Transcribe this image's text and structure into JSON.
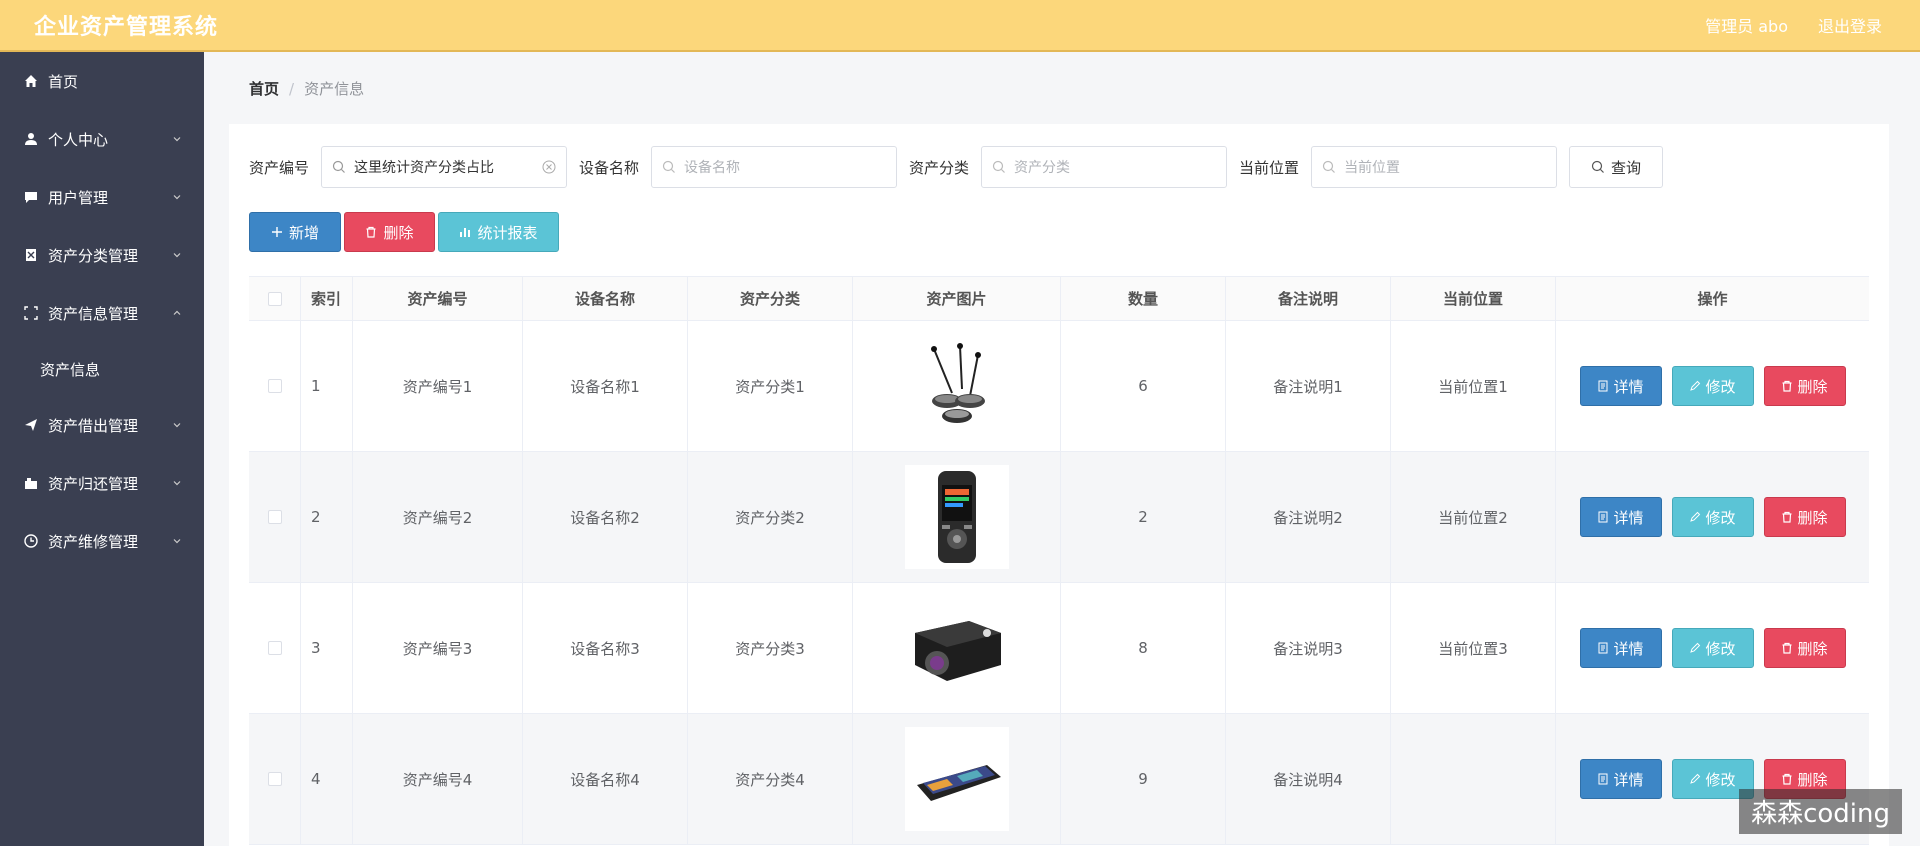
{
  "header": {
    "title": "企业资产管理系统",
    "user": "管理员 abo",
    "logout": "退出登录"
  },
  "sidebar": {
    "items": [
      {
        "label": "首页",
        "icon": "home-icon"
      },
      {
        "label": "个人中心",
        "icon": "user-icon"
      },
      {
        "label": "用户管理",
        "icon": "chat-icon"
      },
      {
        "label": "资产分类管理",
        "icon": "clipboard-icon"
      },
      {
        "label": "资产信息管理",
        "icon": "frame-icon"
      },
      {
        "label": "资产借出管理",
        "icon": "send-icon"
      },
      {
        "label": "资产归还管理",
        "icon": "box-icon"
      },
      {
        "label": "资产维修管理",
        "icon": "clock-icon"
      }
    ],
    "sub_item": "资产信息"
  },
  "breadcrumb": {
    "home": "首页",
    "sep": "/",
    "current": "资产信息"
  },
  "search": {
    "asset_no_label": "资产编号",
    "asset_no_value": "这里统计资产分类占比",
    "device_label": "设备名称",
    "device_placeholder": "设备名称",
    "category_label": "资产分类",
    "category_placeholder": "资产分类",
    "location_label": "当前位置",
    "location_placeholder": "当前位置",
    "query_button": "查询"
  },
  "actions": {
    "add": "新增",
    "delete": "删除",
    "stats": "统计报表"
  },
  "table": {
    "headers": [
      "索引",
      "资产编号",
      "设备名称",
      "资产分类",
      "资产图片",
      "数量",
      "备注说明",
      "当前位置",
      "操作"
    ],
    "rows": [
      {
        "index": "1",
        "asset_no": "资产编号1",
        "device": "设备名称1",
        "category": "资产分类1",
        "image": "microphone",
        "qty": "6",
        "remark": "备注说明1",
        "location": "当前位置1"
      },
      {
        "index": "2",
        "asset_no": "资产编号2",
        "device": "设备名称2",
        "category": "资产分类2",
        "image": "recorder",
        "qty": "2",
        "remark": "备注说明2",
        "location": "当前位置2"
      },
      {
        "index": "3",
        "asset_no": "资产编号3",
        "device": "设备名称3",
        "category": "资产分类3",
        "image": "projector",
        "qty": "8",
        "remark": "备注说明3",
        "location": "当前位置3"
      },
      {
        "index": "4",
        "asset_no": "资产编号4",
        "device": "设备名称4",
        "category": "资产分类4",
        "image": "tablet",
        "qty": "9",
        "remark": "备注说明4",
        "location": ""
      }
    ],
    "row_buttons": {
      "detail": "详情",
      "edit": "修改",
      "delete": "删除"
    }
  },
  "watermark": "森森coding",
  "colors": {
    "topbar": "#fcd77b",
    "sidebar": "#3a3f51",
    "primary": "#3d86c6",
    "danger": "#e84a5f",
    "info": "#5bc4d6"
  }
}
